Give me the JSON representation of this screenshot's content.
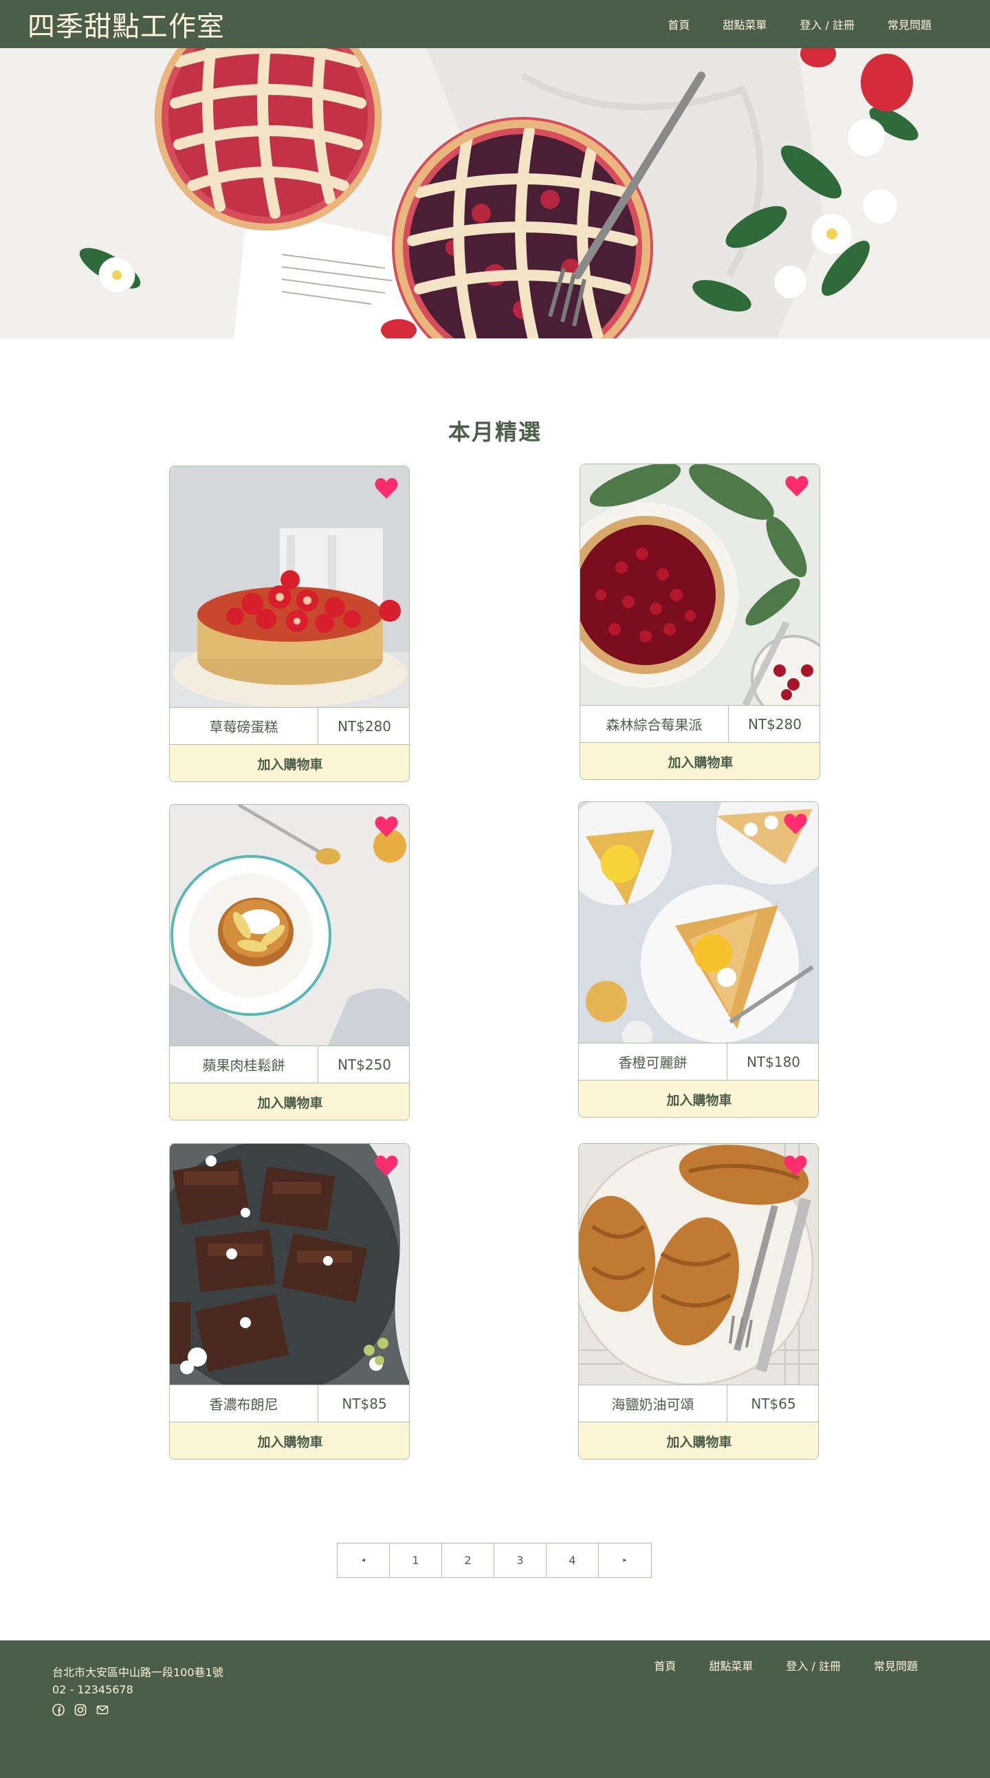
{
  "header": {
    "brand": "四季甜點工作室",
    "nav": [
      "首頁",
      "甜點菜單",
      "登入 / 註冊",
      "常見問題"
    ]
  },
  "section_title": "本月精選",
  "products": [
    {
      "name": "草莓磅蛋糕",
      "price": "NT$280",
      "cart_label": "加入購物車"
    },
    {
      "name": "森林綜合莓果派",
      "price": "NT$280",
      "cart_label": "加入購物車"
    },
    {
      "name": "蘋果肉桂鬆餅",
      "price": "NT$250",
      "cart_label": "加入購物車"
    },
    {
      "name": "香橙可麗餅",
      "price": "NT$180",
      "cart_label": "加入購物車"
    },
    {
      "name": "香濃布朗尼",
      "price": "NT$85",
      "cart_label": "加入購物車"
    },
    {
      "name": "海鹽奶油可頌",
      "price": "NT$65",
      "cart_label": "加入購物車"
    }
  ],
  "pagination": {
    "prev": "◂",
    "pages": [
      "1",
      "2",
      "3",
      "4"
    ],
    "next": "▸"
  },
  "footer": {
    "address": "台北市大安區中山路一段100巷1號",
    "phone": "02 - 12345678",
    "nav": [
      "首頁",
      "甜點菜單",
      "登入 / 註冊",
      "常見問題"
    ],
    "social_icons": [
      "facebook-icon",
      "instagram-icon",
      "mail-icon"
    ]
  },
  "colors": {
    "primary_green": "#4b5e49",
    "cream": "#fdf6dc",
    "cart_button_bg": "#fcf6d6",
    "border_green": "#a8c5a0",
    "heart_pink": "#ff2d6f"
  }
}
